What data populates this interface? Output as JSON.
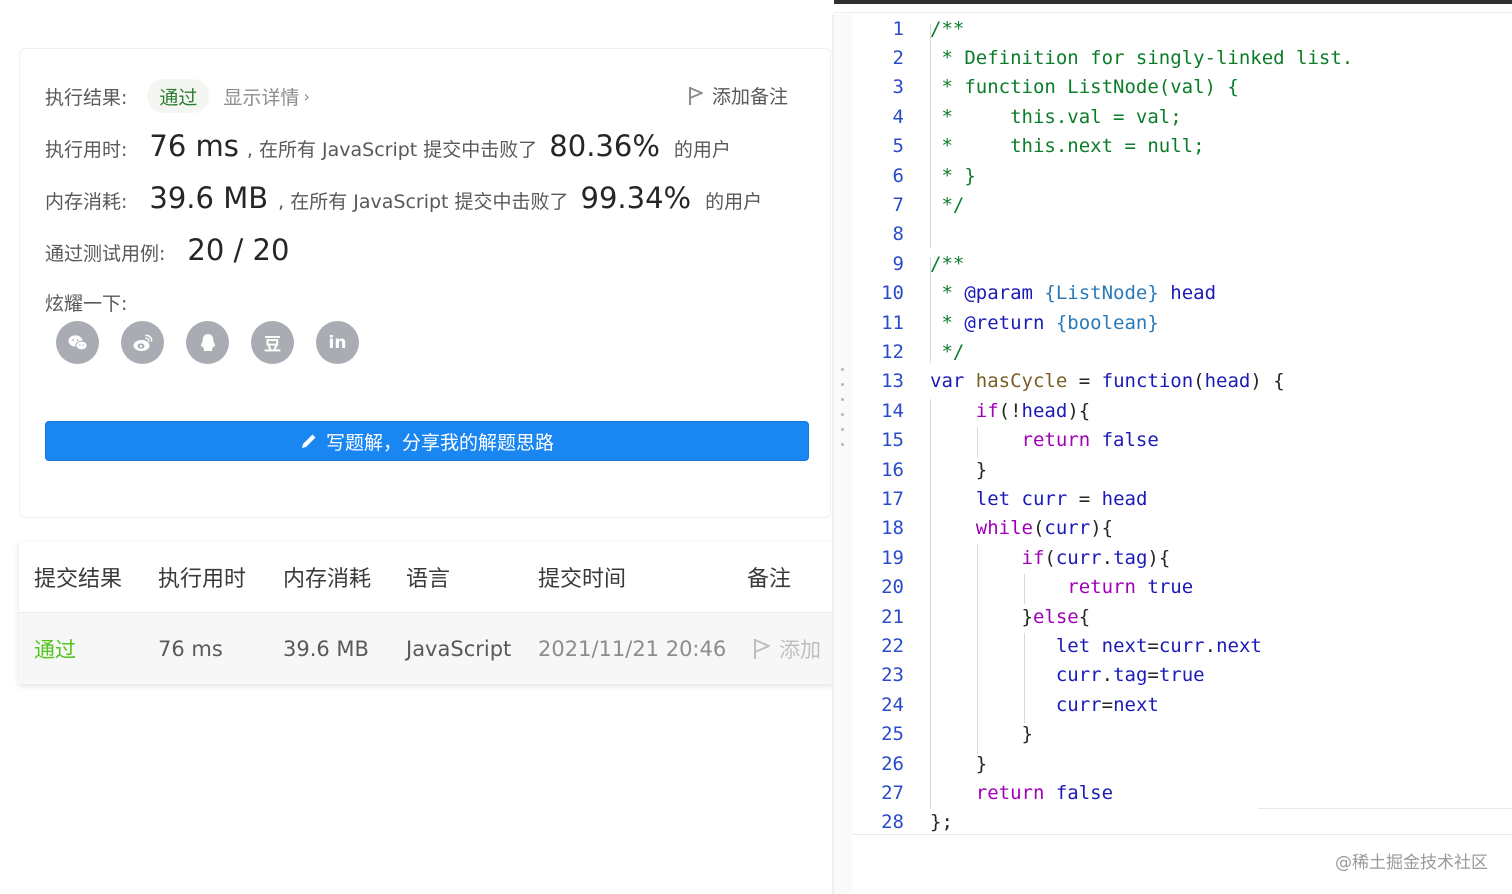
{
  "result": {
    "status_label": "执行结果:",
    "status_badge": "通过",
    "detail_link": "显示详情",
    "add_note": "添加备注",
    "time_label": "执行用时:",
    "time_value": "76 ms",
    "time_text": ", 在所有 JavaScript 提交中击败了",
    "time_percent": "80.36%",
    "time_suffix": "的用户",
    "mem_label": "内存消耗:",
    "mem_value": "39.6 MB",
    "mem_text": ", 在所有 JavaScript 提交中击败了",
    "mem_percent": "99.34%",
    "mem_suffix": "的用户",
    "cases_label": "通过测试用例:",
    "cases_value": "20 / 20",
    "share_label": "炫耀一下:",
    "share_icons": [
      "wechat-icon",
      "weibo-icon",
      "qq-icon",
      "douban-icon",
      "linkedin-icon"
    ],
    "douban_glyph": "豆",
    "linkedin_glyph": "in",
    "write_button": "写题解，分享我的解题思路"
  },
  "submissions": {
    "headers": [
      "提交结果",
      "执行用时",
      "内存消耗",
      "语言",
      "提交时间",
      "备注"
    ],
    "rows": [
      {
        "result": "通过",
        "time": "76 ms",
        "memory": "39.6 MB",
        "language": "JavaScript",
        "submitted": "2021/11/21 20:46",
        "note": "添加"
      }
    ]
  },
  "code": {
    "line_numbers": [
      "1",
      "2",
      "3",
      "4",
      "5",
      "6",
      "7",
      "8",
      "9",
      "10",
      "11",
      "12",
      "13",
      "14",
      "15",
      "16",
      "17",
      "18",
      "19",
      "20",
      "21",
      "22",
      "23",
      "24",
      "25",
      "26",
      "27",
      "28"
    ]
  },
  "watermark": "@稀土掘金技术社区",
  "colors": {
    "accent": "#1a86f2",
    "pass_green": "#52c41a",
    "comment_green": "#0a7d29",
    "keyword_blue": "#1a1ab8",
    "control_purple": "#a000b8"
  }
}
